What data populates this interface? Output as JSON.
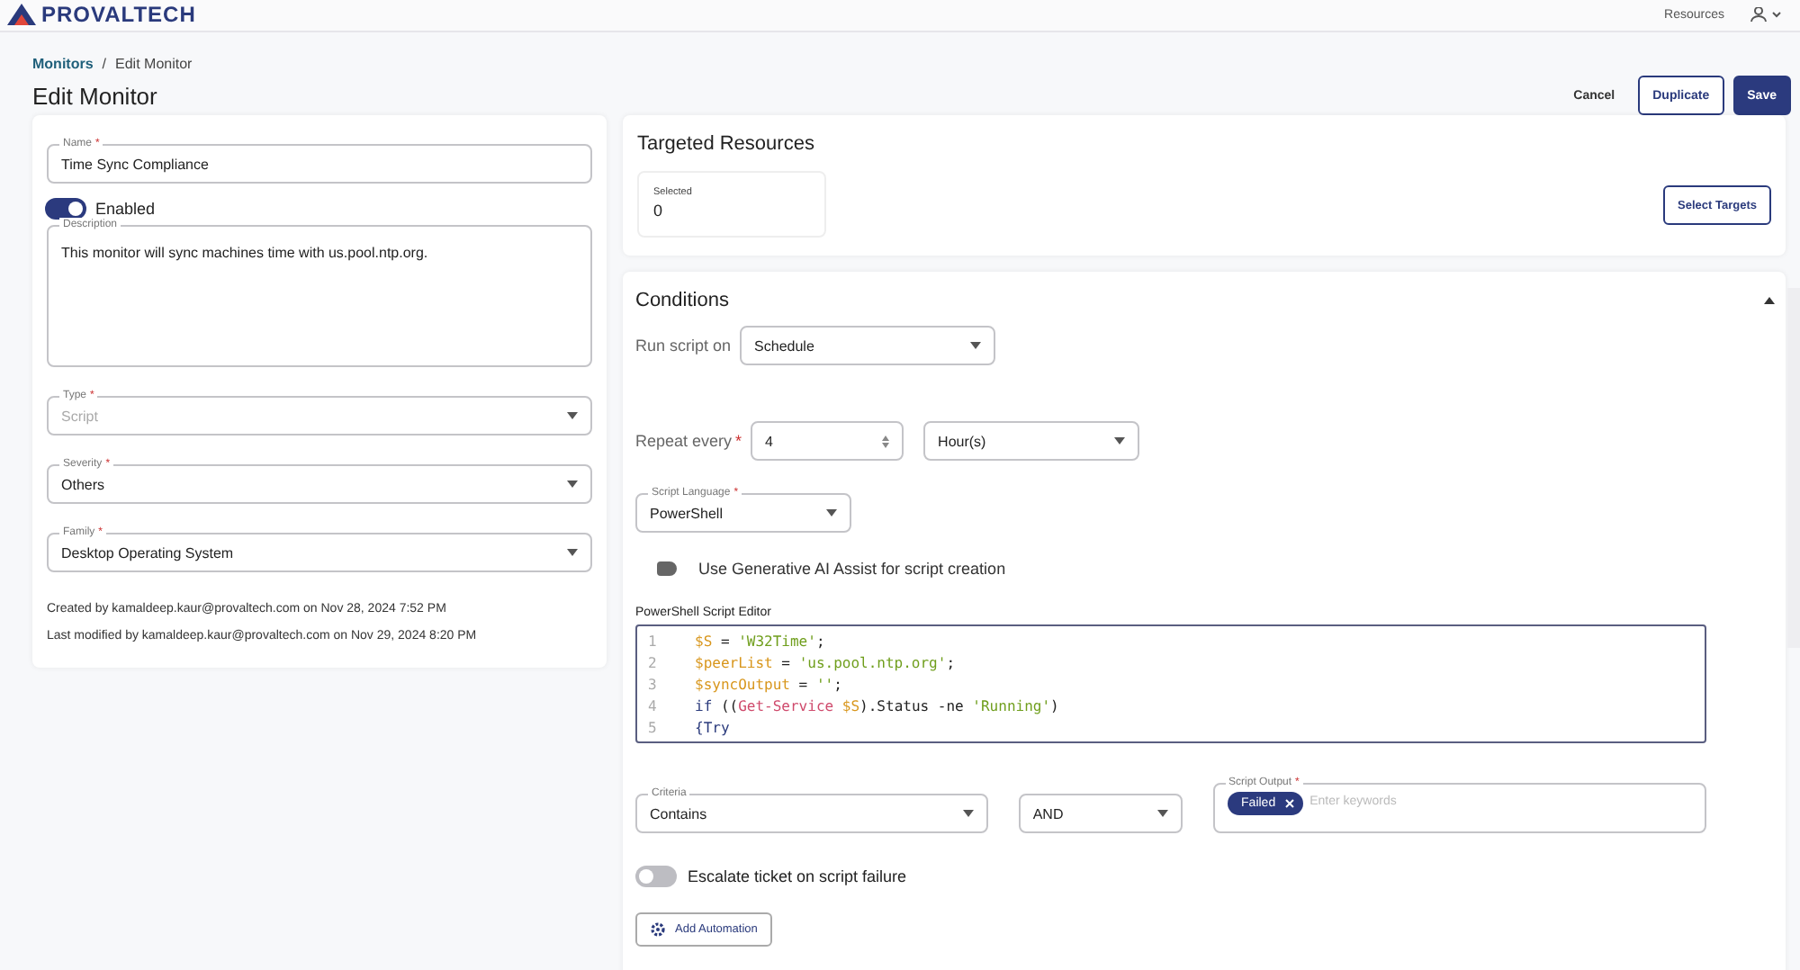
{
  "header": {
    "logo": "PROVALTECH",
    "resources_menu": "Resources"
  },
  "required_marker": "*",
  "breadcrumb": {
    "separator": "/",
    "items": [
      {
        "label": "Monitors",
        "link": true
      },
      {
        "label": "Edit Monitor",
        "link": false
      }
    ]
  },
  "title": "Edit Monitor",
  "actions": [
    {
      "label": "Cancel",
      "kind": "text"
    },
    {
      "label": "Duplicate",
      "kind": "outline"
    },
    {
      "label": "Save",
      "kind": "primary"
    }
  ],
  "details": {
    "name": {
      "label": "Name",
      "required": true,
      "value": "Time Sync Compliance"
    },
    "enabled": {
      "label": "Enabled",
      "on": true
    },
    "description": {
      "label": "Description",
      "value": "This monitor will sync machines time with us.pool.ntp.org."
    },
    "type": {
      "label": "Type",
      "required": true,
      "value": "Script",
      "disabled": true
    },
    "severity": {
      "label": "Severity",
      "required": true,
      "value": "Others",
      "disabled": false
    },
    "family": {
      "label": "Family",
      "required": true,
      "value": "Desktop Operating System",
      "disabled": false
    },
    "created": "Created by kamaldeep.kaur@provaltech.com on Nov 28, 2024 7:52 PM",
    "modified": "Last modified by kamaldeep.kaur@provaltech.com on Nov 29, 2024 8:20 PM"
  },
  "targeted": {
    "title": "Targeted Resources",
    "selected_label": "Selected",
    "selected_value": "0",
    "button": "Select Targets"
  },
  "conditions": {
    "title": "Conditions",
    "expanded": true,
    "run_on": {
      "label": "Run script on",
      "value": "Schedule"
    },
    "repeat": {
      "label": "Repeat every",
      "required": true,
      "value": "4",
      "unit": "Hour(s)"
    },
    "language": {
      "label": "Script Language",
      "required": true,
      "value": "PowerShell"
    },
    "ai_assist": {
      "label": "Use Generative AI Assist for script creation",
      "on": false
    },
    "editor": {
      "label": "PowerShell Script Editor",
      "lines": [
        {
          "number": "1",
          "code": "$S = 'W32Time';"
        },
        {
          "number": "2",
          "code": "$peerList = 'us.pool.ntp.org';"
        },
        {
          "number": "3",
          "code": "$syncOutput = '';"
        },
        {
          "number": "4",
          "code": "if ((Get-Service $S).Status -ne 'Running')"
        },
        {
          "number": "5",
          "code": "{Try"
        }
      ]
    },
    "criteria": {
      "label": "Criteria",
      "value": "Contains"
    },
    "operator": {
      "value": "AND"
    },
    "output": {
      "label": "Script Output",
      "required": true,
      "tags": [
        "Failed"
      ],
      "placeholder": "Enter keywords"
    },
    "escalate": {
      "label": "Escalate ticket on script failure",
      "on": false
    },
    "automation_button": "Add Automation"
  }
}
